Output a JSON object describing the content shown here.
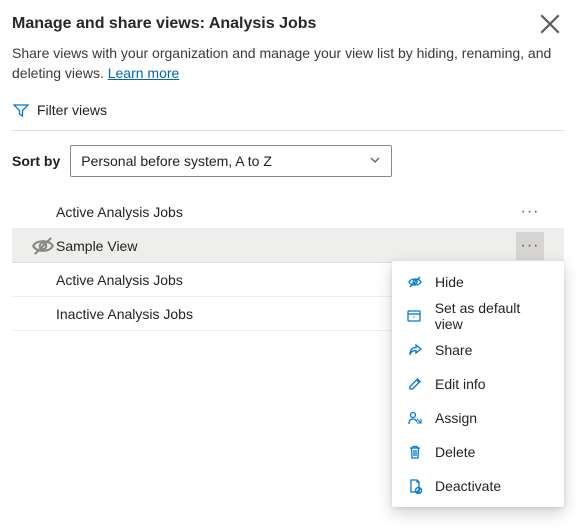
{
  "header": {
    "title": "Manage and share views: Analysis Jobs",
    "description_pre": "Share views with your organization and manage your view list by hiding, renaming, and deleting views. ",
    "learn_more": "Learn more"
  },
  "filter": {
    "label": "Filter views"
  },
  "sort": {
    "label": "Sort by",
    "selected": "Personal before system, A to Z"
  },
  "views": [
    {
      "name": "Active Analysis Jobs",
      "personal": true,
      "hidden": false,
      "selected": false,
      "show_more": true
    },
    {
      "name": "Sample View",
      "personal": true,
      "hidden": true,
      "selected": true,
      "show_more": true
    },
    {
      "name": "Active Analysis Jobs",
      "personal": false,
      "hidden": false,
      "selected": false,
      "show_more": false
    },
    {
      "name": "Inactive Analysis Jobs",
      "personal": false,
      "hidden": false,
      "selected": false,
      "show_more": false
    }
  ],
  "context_menu": {
    "items": [
      {
        "icon": "hide-icon",
        "label": "Hide"
      },
      {
        "icon": "default-icon",
        "label": "Set as default view"
      },
      {
        "icon": "share-icon",
        "label": "Share"
      },
      {
        "icon": "edit-icon",
        "label": "Edit info"
      },
      {
        "icon": "assign-icon",
        "label": "Assign"
      },
      {
        "icon": "delete-icon",
        "label": "Delete"
      },
      {
        "icon": "deactivate-icon",
        "label": "Deactivate"
      }
    ]
  }
}
